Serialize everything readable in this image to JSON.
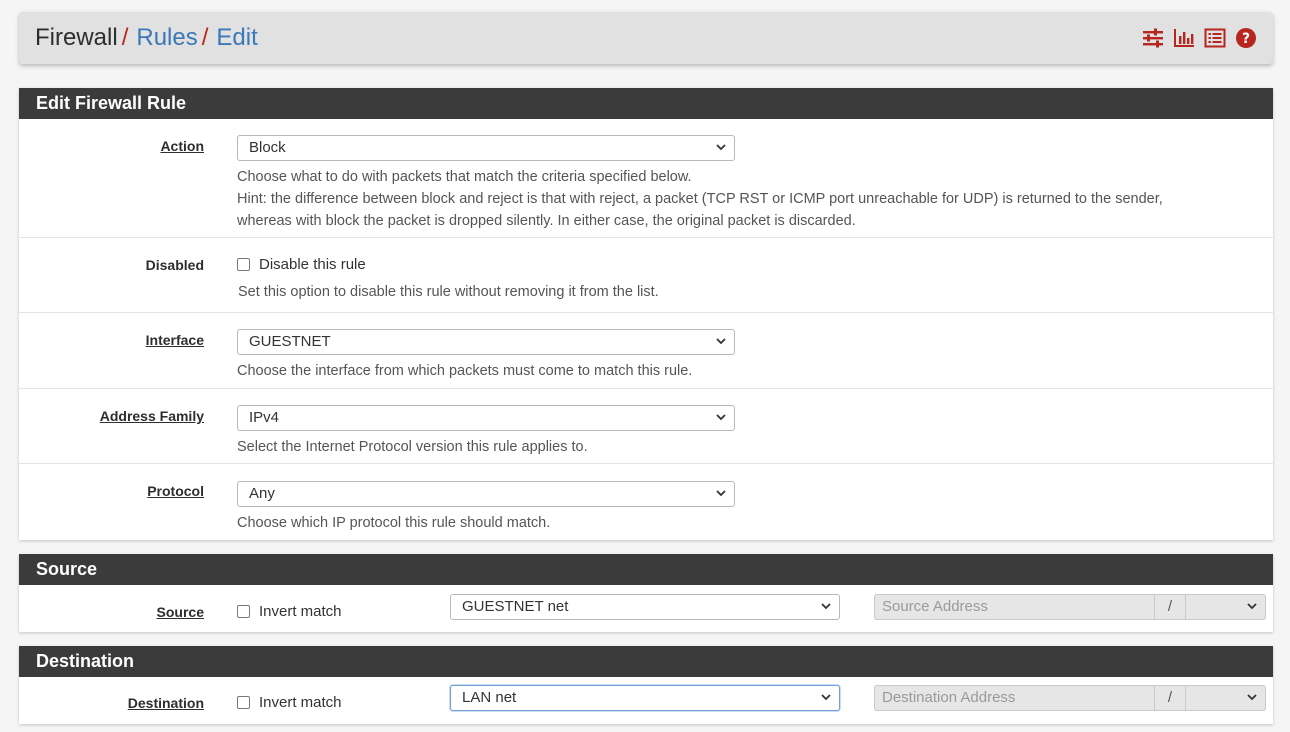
{
  "breadcrumb": {
    "root": "Firewall",
    "sep": "/",
    "rules": "Rules",
    "edit": "Edit"
  },
  "header_icons": [
    "sliders-icon",
    "bar-chart-icon",
    "list-icon",
    "help-icon"
  ],
  "colors": {
    "accent_red": "#b8251f",
    "link_blue": "#3a78b8",
    "panel_head": "#3b3b3b"
  },
  "edit_panel": {
    "title": "Edit Firewall Rule",
    "action": {
      "label": "Action",
      "value": "Block",
      "help1": "Choose what to do with packets that match the criteria specified below.",
      "help2": "Hint: the difference between block and reject is that with reject, a packet (TCP RST or ICMP port unreachable for UDP) is returned to the sender,",
      "help3": "whereas with block the packet is dropped silently. In either case, the original packet is discarded."
    },
    "disabled": {
      "label": "Disabled",
      "checkbox_label": "Disable this rule",
      "checked": false,
      "help": "Set this option to disable this rule without removing it from the list."
    },
    "interface": {
      "label": "Interface",
      "value": "GUESTNET",
      "help": "Choose the interface from which packets must come to match this rule."
    },
    "address_family": {
      "label": "Address Family",
      "value": "IPv4",
      "help": "Select the Internet Protocol version this rule applies to."
    },
    "protocol": {
      "label": "Protocol",
      "value": "Any",
      "help": "Choose which IP protocol this rule should match."
    }
  },
  "source_panel": {
    "title": "Source",
    "label": "Source",
    "invert_label": "Invert match",
    "invert_checked": false,
    "type_value": "GUESTNET net",
    "address_placeholder": "Source Address",
    "slash": "/"
  },
  "destination_panel": {
    "title": "Destination",
    "label": "Destination",
    "invert_label": "Invert match",
    "invert_checked": false,
    "type_value": "LAN net",
    "address_placeholder": "Destination Address",
    "slash": "/"
  }
}
